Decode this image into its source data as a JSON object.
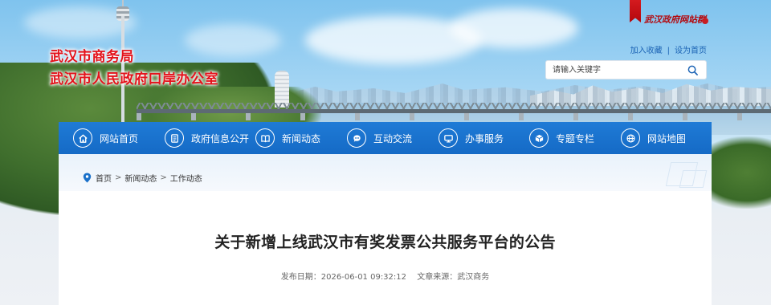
{
  "header": {
    "title_line1": "武汉市商务局",
    "title_line2": "武汉市人民政府口岸办公室",
    "emblem_text": "武汉政府网站群",
    "links": [
      {
        "label": "加入收藏"
      },
      {
        "label": "设为首页"
      }
    ],
    "search": {
      "placeholder": "请输入关键字",
      "icon": "search-icon"
    }
  },
  "nav": {
    "items": [
      {
        "label": "网站首页",
        "icon": "home-icon"
      },
      {
        "label": "政府信息公开",
        "icon": "document-icon"
      },
      {
        "label": "新闻动态",
        "icon": "book-icon"
      },
      {
        "label": "互动交流",
        "icon": "chat-icon"
      },
      {
        "label": "办事服务",
        "icon": "monitor-icon"
      },
      {
        "label": "专题专栏",
        "icon": "cube-icon"
      },
      {
        "label": "网站地图",
        "icon": "globe-icon"
      }
    ]
  },
  "breadcrumb": {
    "icon": "location-pin-icon",
    "items": [
      {
        "label": "首页"
      },
      {
        "label": "新闻动态"
      },
      {
        "label": "工作动态"
      }
    ]
  },
  "article": {
    "title": "关于新增上线武汉市有奖发票公共服务平台的公告",
    "publish_label": "发布日期：",
    "publish_date": "2026-06-01 09:32:12",
    "source_label": "文章来源：",
    "source": "武汉商务"
  },
  "colors": {
    "title_red": "#e4121b",
    "nav_blue": "#1a70c9",
    "link_blue": "#1a62b4"
  }
}
